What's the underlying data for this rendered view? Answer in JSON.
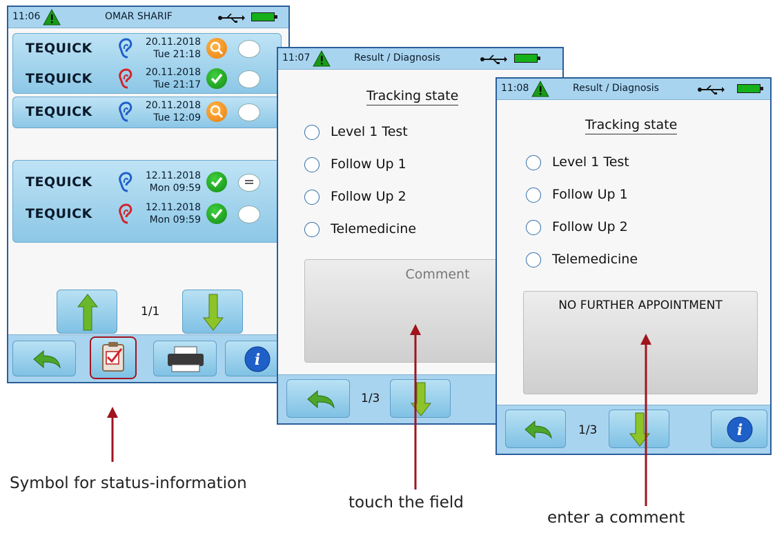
{
  "screen1": {
    "time": "11:06",
    "title": "OMAR SHARIF",
    "groups": [
      {
        "entries": [
          {
            "name": "TEQUICK",
            "ear": "right-ear-icon",
            "date": "20.11.2018",
            "time": "Tue 21:18",
            "status": "search"
          },
          {
            "name": "TEQUICK",
            "ear": "left-ear-icon",
            "date": "20.11.2018",
            "time": "Tue 21:17",
            "status": "check"
          }
        ]
      },
      {
        "entries": [
          {
            "name": "TEQUICK",
            "ear": "right-ear-icon",
            "date": "20.11.2018",
            "time": "Tue 12:09",
            "status": "search"
          }
        ]
      },
      {
        "entries": [
          {
            "name": "TEQUICK",
            "ear": "right-ear-icon",
            "date": "12.11.2018",
            "time": "Mon 09:59",
            "status": "check"
          },
          {
            "name": "TEQUICK",
            "ear": "left-ear-icon",
            "date": "12.11.2018",
            "time": "Mon 09:59",
            "status": "check"
          }
        ]
      }
    ],
    "page": "1/1"
  },
  "screen2": {
    "time": "11:07",
    "title": "Result / Diagnosis",
    "heading": "Tracking state",
    "options": [
      "Level 1 Test",
      "Follow Up 1",
      "Follow Up 2",
      "Telemedicine"
    ],
    "comment_placeholder": "Comment",
    "page": "1/3"
  },
  "screen3": {
    "time": "11:08",
    "title": "Result / Diagnosis",
    "heading": "Tracking state",
    "options": [
      "Level 1 Test",
      "Follow Up 1",
      "Follow Up 2",
      "Telemedicine"
    ],
    "comment_value": "NO FURTHER APPOINTMENT",
    "page": "1/3"
  },
  "captions": {
    "status_symbol": "Symbol for status-information",
    "touch": "touch the field",
    "enter": "enter a comment"
  },
  "colors": {
    "frame": "#2a5d9a",
    "statusbar": "#a9d4ef",
    "annotation": "#a0141e",
    "check_green": "#1a9a1a",
    "search_orange": "#ee8a14"
  }
}
